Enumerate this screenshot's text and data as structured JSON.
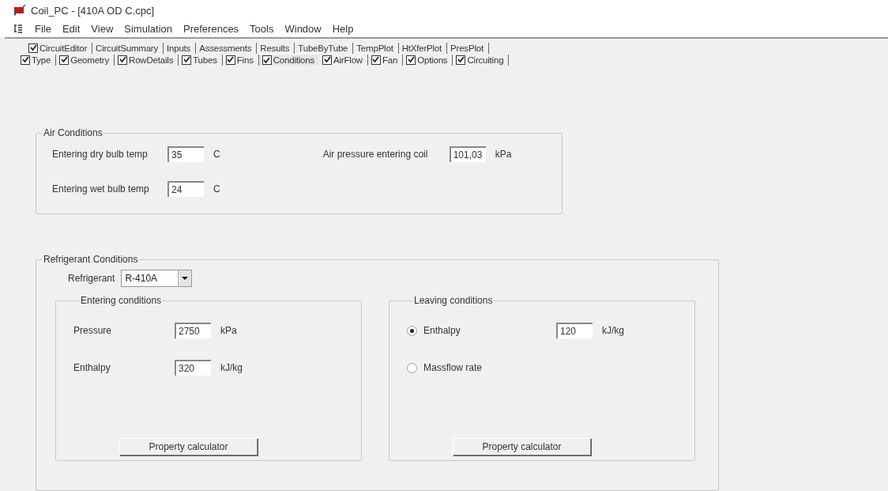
{
  "window": {
    "title": "Coil_PC - [410A OD C.cpc]"
  },
  "menu": [
    "File",
    "Edit",
    "View",
    "Simulation",
    "Preferences",
    "Tools",
    "Window",
    "Help"
  ],
  "tabs_row_1": [
    {
      "label": "CircuitEditor",
      "kind": "checkbox",
      "checked": true,
      "selected": false
    },
    {
      "label": "CircuitSummary",
      "kind": "plain",
      "selected": false
    },
    {
      "label": "Inputs",
      "kind": "plain",
      "selected": false
    },
    {
      "label": "Assessments",
      "kind": "plain",
      "selected": false
    },
    {
      "label": "Results",
      "kind": "plain",
      "selected": false
    },
    {
      "label": "TubeByTube",
      "kind": "plain",
      "selected": false
    },
    {
      "label": "TempPlot",
      "kind": "plain",
      "selected": false
    },
    {
      "label": "HtXferPlot",
      "kind": "plain",
      "selected": false
    },
    {
      "label": "PresPlot",
      "kind": "plain",
      "selected": false
    }
  ],
  "tabs_row_2": [
    {
      "label": "Type",
      "kind": "checkbox",
      "checked": true,
      "selected": false
    },
    {
      "label": "Geometry",
      "kind": "checkbox",
      "checked": true,
      "selected": false
    },
    {
      "label": "RowDetails",
      "kind": "checkbox",
      "checked": true,
      "selected": false
    },
    {
      "label": "Tubes",
      "kind": "checkbox",
      "checked": true,
      "selected": false
    },
    {
      "label": "Fins",
      "kind": "checkbox",
      "checked": true,
      "selected": false
    },
    {
      "label": "Conditions",
      "kind": "checkbox",
      "checked": true,
      "selected": true
    },
    {
      "label": "AirFlow",
      "kind": "checkbox",
      "checked": true,
      "selected": false
    },
    {
      "label": "Fan",
      "kind": "checkbox",
      "checked": true,
      "selected": false
    },
    {
      "label": "Options",
      "kind": "checkbox",
      "checked": true,
      "selected": false
    },
    {
      "label": "Circuiting",
      "kind": "checkbox",
      "checked": true,
      "selected": false
    }
  ],
  "air_conditions": {
    "title": "Air Conditions",
    "dry_bulb": {
      "label": "Entering dry bulb temp",
      "value": "35",
      "unit": "C"
    },
    "wet_bulb": {
      "label": "Entering wet bulb temp",
      "value": "24",
      "unit": "C"
    },
    "pressure": {
      "label": "Air pressure entering coil",
      "value": "101,03",
      "unit": "kPa"
    }
  },
  "refrigerant_conditions": {
    "title": "Refrigerant Conditions",
    "refrigerant": {
      "label": "Refrigerant",
      "value": "R-410A"
    },
    "entering": {
      "title": "Entering conditions",
      "fields": [
        {
          "label": "Pressure",
          "value": "2750",
          "unit": "kPa"
        },
        {
          "label": "Enthalpy",
          "value": "320",
          "unit": "kJ/kg"
        }
      ],
      "button": "Property calculator"
    },
    "leaving": {
      "title": "Leaving conditions",
      "options": [
        {
          "label": "Enthalpy",
          "selected": true,
          "value": "120",
          "unit": "kJ/kg"
        },
        {
          "label": "Massflow rate",
          "selected": false
        }
      ],
      "button": "Property calculator"
    }
  }
}
